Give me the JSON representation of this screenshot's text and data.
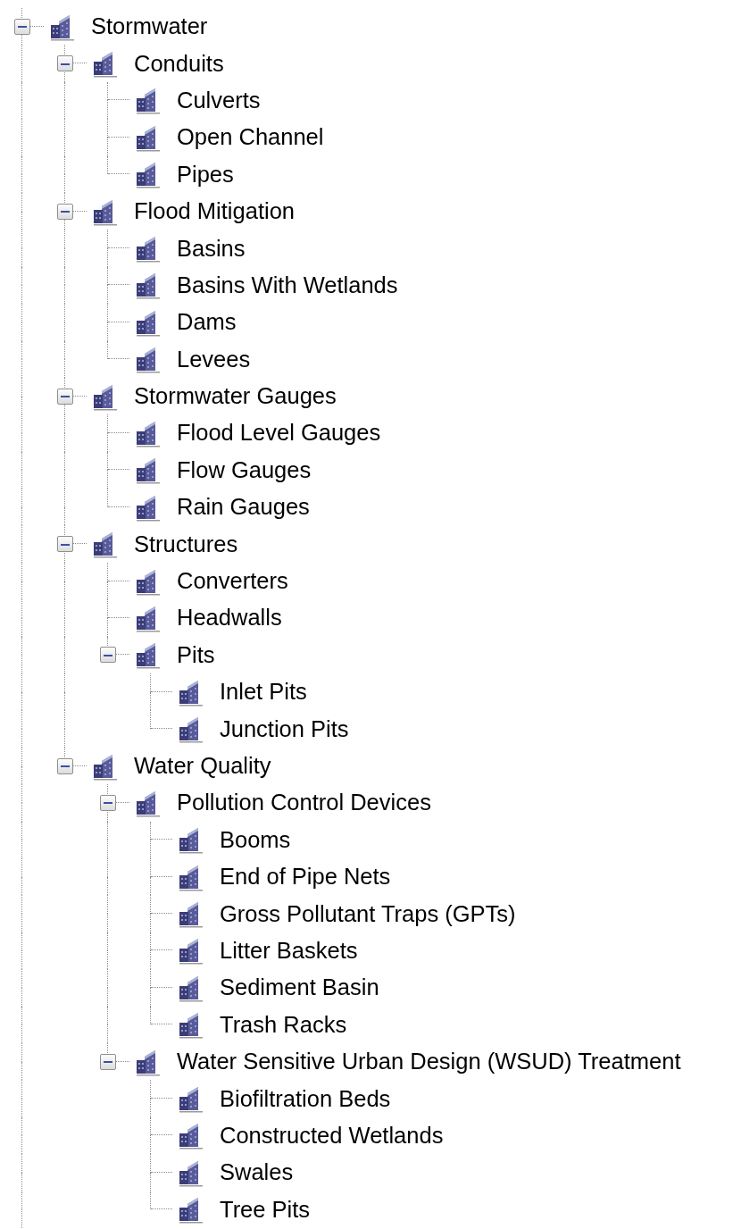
{
  "tree": [
    {
      "label": "Stormwater",
      "expanded": true,
      "children": [
        {
          "label": "Conduits",
          "expanded": true,
          "children": [
            {
              "label": "Culverts"
            },
            {
              "label": "Open Channel"
            },
            {
              "label": "Pipes"
            }
          ]
        },
        {
          "label": "Flood Mitigation",
          "expanded": true,
          "children": [
            {
              "label": "Basins"
            },
            {
              "label": "Basins With Wetlands"
            },
            {
              "label": "Dams"
            },
            {
              "label": "Levees"
            }
          ]
        },
        {
          "label": "Stormwater Gauges",
          "expanded": true,
          "children": [
            {
              "label": "Flood Level Gauges"
            },
            {
              "label": "Flow Gauges"
            },
            {
              "label": "Rain Gauges"
            }
          ]
        },
        {
          "label": "Structures",
          "expanded": true,
          "children": [
            {
              "label": "Converters"
            },
            {
              "label": "Headwalls"
            },
            {
              "label": "Pits",
              "expanded": true,
              "children": [
                {
                  "label": "Inlet Pits"
                },
                {
                  "label": "Junction Pits"
                }
              ]
            }
          ]
        },
        {
          "label": "Water Quality",
          "expanded": true,
          "children": [
            {
              "label": "Pollution Control Devices",
              "expanded": true,
              "children": [
                {
                  "label": "Booms"
                },
                {
                  "label": "End of Pipe Nets"
                },
                {
                  "label": "Gross Pollutant Traps (GPTs)"
                },
                {
                  "label": "Litter Baskets"
                },
                {
                  "label": "Sediment Basin"
                },
                {
                  "label": "Trash Racks"
                }
              ]
            },
            {
              "label": "Water Sensitive Urban Design (WSUD) Treatment",
              "expanded": true,
              "children": [
                {
                  "label": "Biofiltration Beds"
                },
                {
                  "label": "Constructed Wetlands"
                },
                {
                  "label": "Swales"
                },
                {
                  "label": "Tree Pits"
                }
              ]
            }
          ]
        }
      ]
    }
  ]
}
